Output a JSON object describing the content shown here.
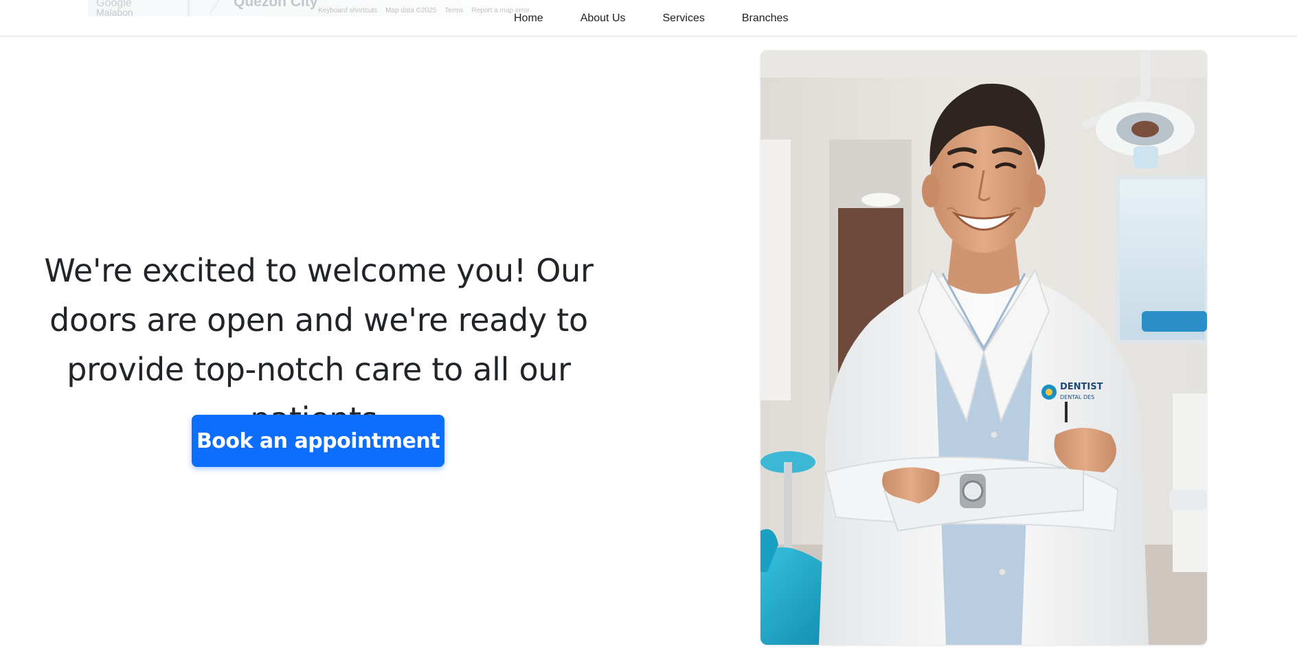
{
  "map": {
    "logo_text": "Google",
    "place_label": "Malabon",
    "city_label": "Quezon City",
    "footer_links": [
      "Keyboard shortcuts",
      "Map data ©2025",
      "Terms",
      "Report a map error"
    ]
  },
  "nav": {
    "items": [
      {
        "label": "Home"
      },
      {
        "label": "About Us"
      },
      {
        "label": "Services"
      },
      {
        "label": "Branches"
      }
    ]
  },
  "hero": {
    "heading": "We're excited to welcome you! Our doors are open and we're ready to provide top-notch care to all our patients.",
    "cta_label": "Book an appointment"
  },
  "photo": {
    "coat_logo_line1": "DENTIST",
    "coat_logo_line2": "DENTAL DES"
  },
  "colors": {
    "primary": "#0d6efd",
    "text": "#212529",
    "nav_text": "#1f1f1f",
    "chair_teal": "#1aa6c8"
  }
}
